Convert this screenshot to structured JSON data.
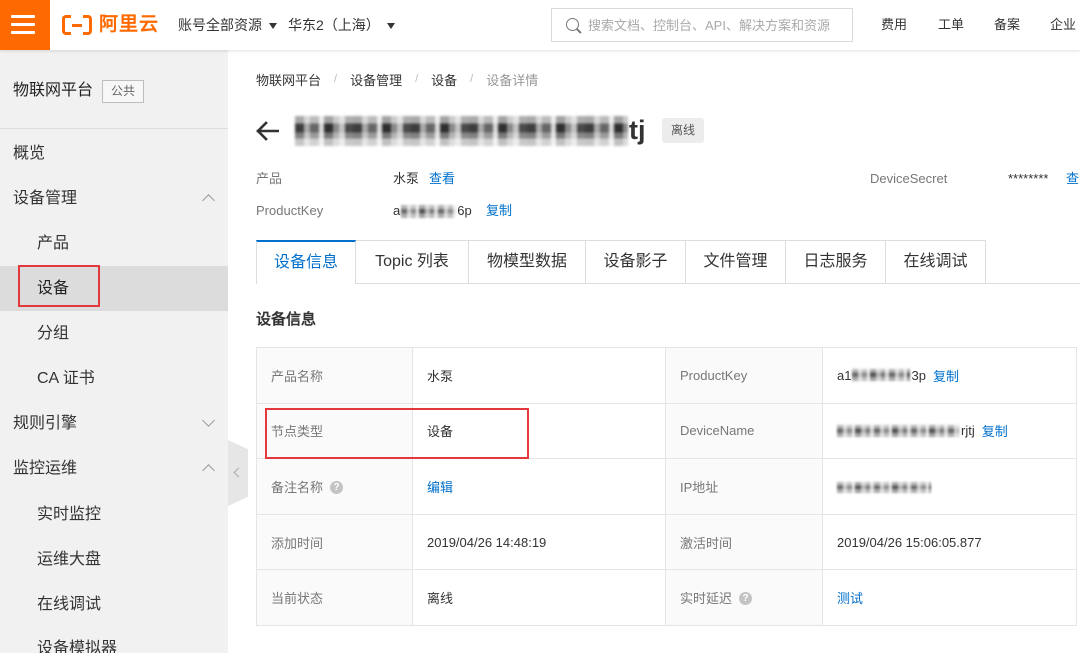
{
  "colors": {
    "brand_orange": "#ff6a00",
    "link_blue": "#0070cc",
    "highlight_red": "#e4393c"
  },
  "header": {
    "menu_icon": "hamburger-icon",
    "logo_icon": "aliyun-logo-icon",
    "logo_text": "阿里云",
    "account_scope": "账号全部资源",
    "region": "华东2（上海）",
    "search_icon": "search-icon",
    "search_placeholder": "搜索文档、控制台、API、解决方案和资源",
    "nav": [
      "费用",
      "工单",
      "备案",
      "企业"
    ]
  },
  "sidebar": {
    "title": "物联网平台",
    "badge": "公共",
    "items": [
      {
        "label": "概览"
      },
      {
        "label": "设备管理",
        "expanded": true
      },
      {
        "label": "产品"
      },
      {
        "label": "设备",
        "selected": true
      },
      {
        "label": "分组"
      },
      {
        "label": "CA 证书"
      },
      {
        "label": "规则引擎",
        "expanded": false
      },
      {
        "label": "监控运维",
        "expanded": true
      },
      {
        "label": "实时监控"
      },
      {
        "label": "运维大盘"
      },
      {
        "label": "在线调试"
      },
      {
        "label": "设备模拟器"
      }
    ]
  },
  "breadcrumb": [
    "物联网平台",
    "设备管理",
    "设备",
    "设备详情"
  ],
  "device": {
    "name_visible_suffix": "tj",
    "status": "离线"
  },
  "summary": {
    "product": {
      "label": "产品",
      "value": "水泵",
      "action": "查看"
    },
    "product_key": {
      "label": "ProductKey",
      "value_prefix": "a",
      "value_suffix": "6p",
      "action": "复制"
    },
    "device_secret": {
      "label": "DeviceSecret",
      "value": "********",
      "action": "查"
    }
  },
  "tabs": [
    {
      "label": "设备信息",
      "active": true
    },
    {
      "label": "Topic 列表"
    },
    {
      "label": "物模型数据"
    },
    {
      "label": "设备影子"
    },
    {
      "label": "文件管理"
    },
    {
      "label": "日志服务"
    },
    {
      "label": "在线调试"
    }
  ],
  "section_title": "设备信息",
  "table": {
    "rows": [
      {
        "label1": "产品名称",
        "value1": "水泵",
        "label2": "ProductKey",
        "value2_prefix": "a1",
        "value2_suffix": "3p",
        "action2": "复制"
      },
      {
        "label1": "节点类型",
        "value1": "设备",
        "label2": "DeviceName",
        "value2_suffix": "rjtj",
        "action2": "复制"
      },
      {
        "label1": "备注名称",
        "action1": "编辑",
        "label2": "IP地址"
      },
      {
        "label1": "添加时间",
        "value1": "2019/04/26 14:48:19",
        "label2": "激活时间",
        "value2": "2019/04/26 15:06:05.877"
      },
      {
        "label1": "当前状态",
        "value1": "离线",
        "label2": "实时延迟",
        "action2": "测试"
      }
    ]
  }
}
